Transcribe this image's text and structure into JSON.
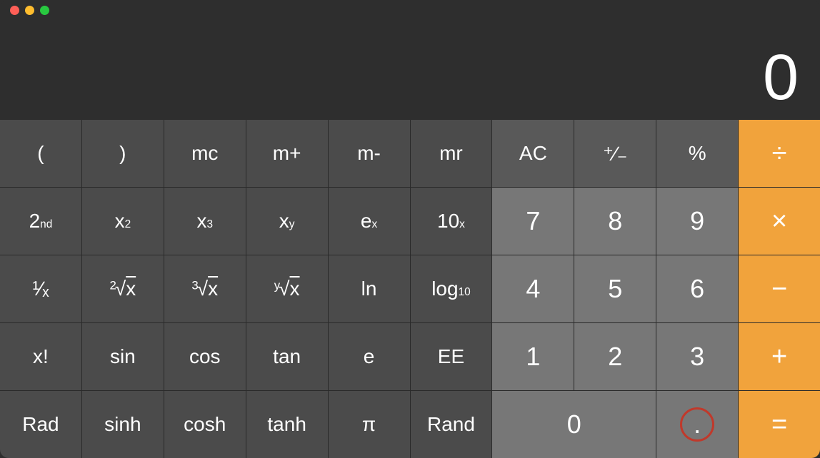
{
  "window": {
    "traffic_lights": {
      "close": "#ff5f57",
      "minimize": "#ffbd2e",
      "zoom": "#28c940"
    }
  },
  "display": {
    "value": "0"
  },
  "keys": {
    "paren_open": "(",
    "paren_close": ")",
    "mc": "mc",
    "mplus": "m+",
    "mminus": "m-",
    "mr": "mr",
    "ac": "AC",
    "plus_minus": "⁺∕₋",
    "percent": "%",
    "divide": "÷",
    "second": {
      "base": "2",
      "sup": "nd"
    },
    "x2": {
      "base": "x",
      "sup": "2"
    },
    "x3": {
      "base": "x",
      "sup": "3"
    },
    "xy": {
      "base": "x",
      "sup": "y"
    },
    "ex": {
      "base": "e",
      "sup": "x"
    },
    "tenx": {
      "base": "10",
      "sup": "x"
    },
    "seven": "7",
    "eight": "8",
    "nine": "9",
    "multiply": "×",
    "reciprocal": "¹∕ₓ",
    "sqrt": {
      "pre": "2",
      "rad": "√",
      "body": "x"
    },
    "cbrt": {
      "pre": "3",
      "rad": "√",
      "body": "x"
    },
    "yroot": {
      "pre": "y",
      "rad": "√",
      "body": "x"
    },
    "ln": "ln",
    "log10": {
      "base": "log",
      "sub": "10"
    },
    "four": "4",
    "five": "5",
    "six": "6",
    "minus": "−",
    "factorial": "x!",
    "sin": "sin",
    "cos": "cos",
    "tan": "tan",
    "e": "e",
    "ee": "EE",
    "one": "1",
    "two": "2",
    "three": "3",
    "plus": "+",
    "rad": "Rad",
    "sinh": "sinh",
    "cosh": "cosh",
    "tanh": "tanh",
    "pi": "π",
    "rand": "Rand",
    "zero": "0",
    "decimal": ".",
    "equals": "="
  }
}
